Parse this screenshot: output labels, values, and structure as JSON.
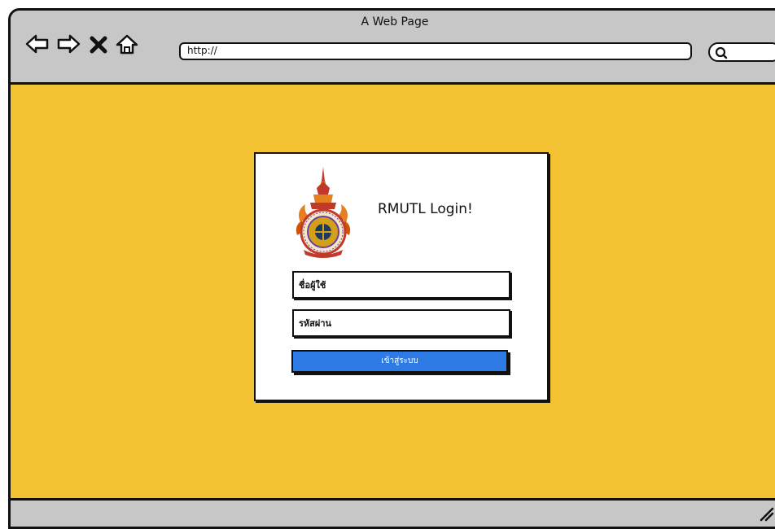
{
  "window": {
    "title": "A Web Page",
    "url": "http://"
  },
  "login": {
    "title": "RMUTL Login!",
    "username_placeholder": "ชื่อผู้ใช้",
    "password_placeholder": "รหัสผ่าน",
    "submit_label": "เข้าสู่ระบบ"
  },
  "colors": {
    "page_background": "#f2c232",
    "chrome": "#c7c7c7",
    "button": "#2f7be6"
  },
  "icons": [
    "back-arrow-icon",
    "forward-arrow-icon",
    "stop-icon",
    "home-icon",
    "search-icon",
    "resize-grip-icon",
    "university-emblem"
  ]
}
